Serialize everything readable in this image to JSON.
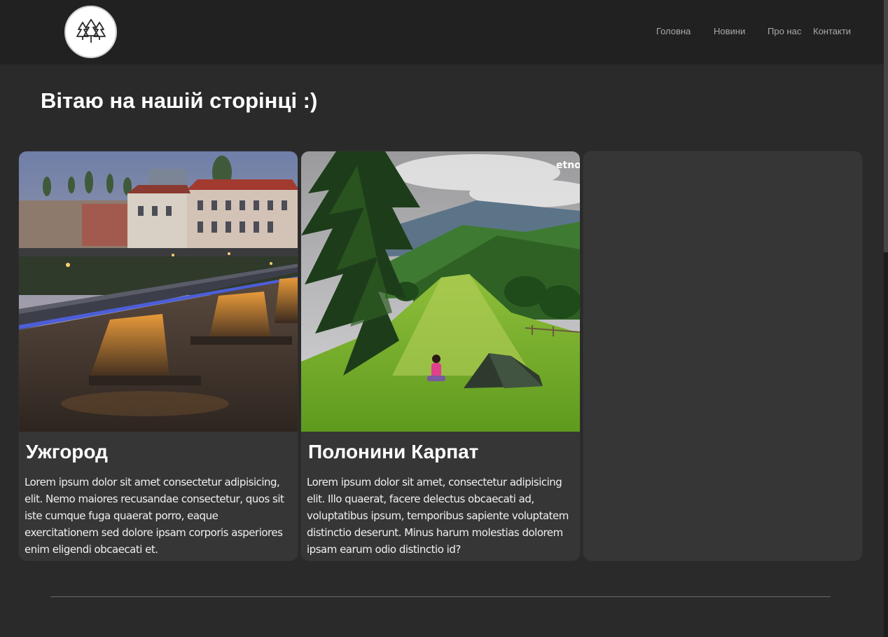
{
  "header": {
    "logo_icon": "pine-trees-icon",
    "nav": [
      {
        "label": "Головна"
      },
      {
        "label": "Новини"
      },
      {
        "label": "Про нас"
      },
      {
        "label": "Контакти"
      }
    ]
  },
  "main": {
    "title": "Вітаю на нашій сторінці :)",
    "cards": [
      {
        "title": "Ужгород",
        "image_icon": "city-bridge-photo",
        "text": "Lorem ipsum dolor sit amet consectetur adipisicing, elit. Nemo maiores recusandae consectetur, quos sit iste cumque fuga quaerat porro, eaque exercitationem sed dolore ipsam corporis asperiores enim eligendi obcaecati et."
      },
      {
        "title": "Полонини Карпат",
        "image_icon": "mountain-camp-photo",
        "watermark": "etno",
        "text": "Lorem ipsum dolor sit amet, consectetur adipisicing elit. Illo quaerat, facere delectus obcaecati ad, voluptatibus ipsum, temporibus sapiente voluptatem distinctio deserunt. Minus harum molestias dolorem ipsam earum odio distinctio id?"
      }
    ]
  },
  "colors": {
    "background": "#2a2a2a",
    "header": "#212121",
    "card": "#363636",
    "nav_text": "#a9a9a9",
    "heading": "#ffffff"
  }
}
